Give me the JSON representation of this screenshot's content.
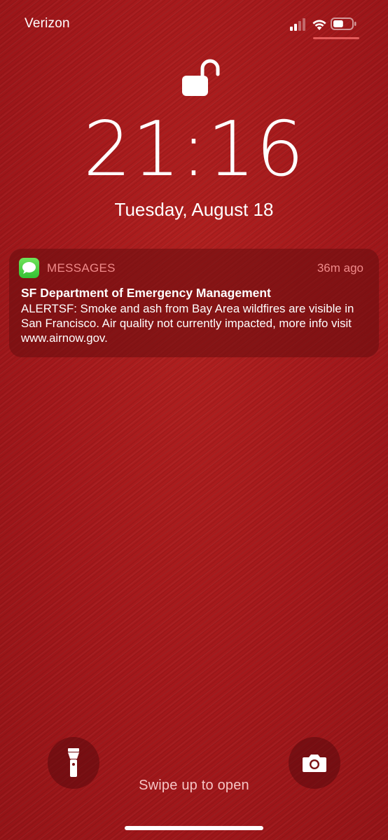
{
  "status_bar": {
    "carrier": "Verizon",
    "signal_bars_active": 2,
    "signal_bars_total": 4,
    "wifi": "wifi-icon",
    "battery": "battery-icon",
    "battery_level": 0.55
  },
  "lock_screen": {
    "lock_icon": "unlocked-padlock-icon",
    "time": "21:16",
    "date": "Tuesday, August 18"
  },
  "notification": {
    "app_icon": "messages-app-icon",
    "app_name": "MESSAGES",
    "time_ago": "36m ago",
    "title": "SF Department of Emergency Management",
    "body": "ALERTSF: Smoke and ash from Bay Area wildfires are visible in San Francisco. Air quality not currently impacted, more info visit www.airnow.gov."
  },
  "bottom": {
    "flashlight_icon": "flashlight-icon",
    "camera_icon": "camera-icon",
    "swipe_hint": "Swipe up to open"
  },
  "colors": {
    "wallpaper": "#a8191c",
    "notification_meta": "#f08a8a",
    "app_icon_green": "#4cd448"
  }
}
